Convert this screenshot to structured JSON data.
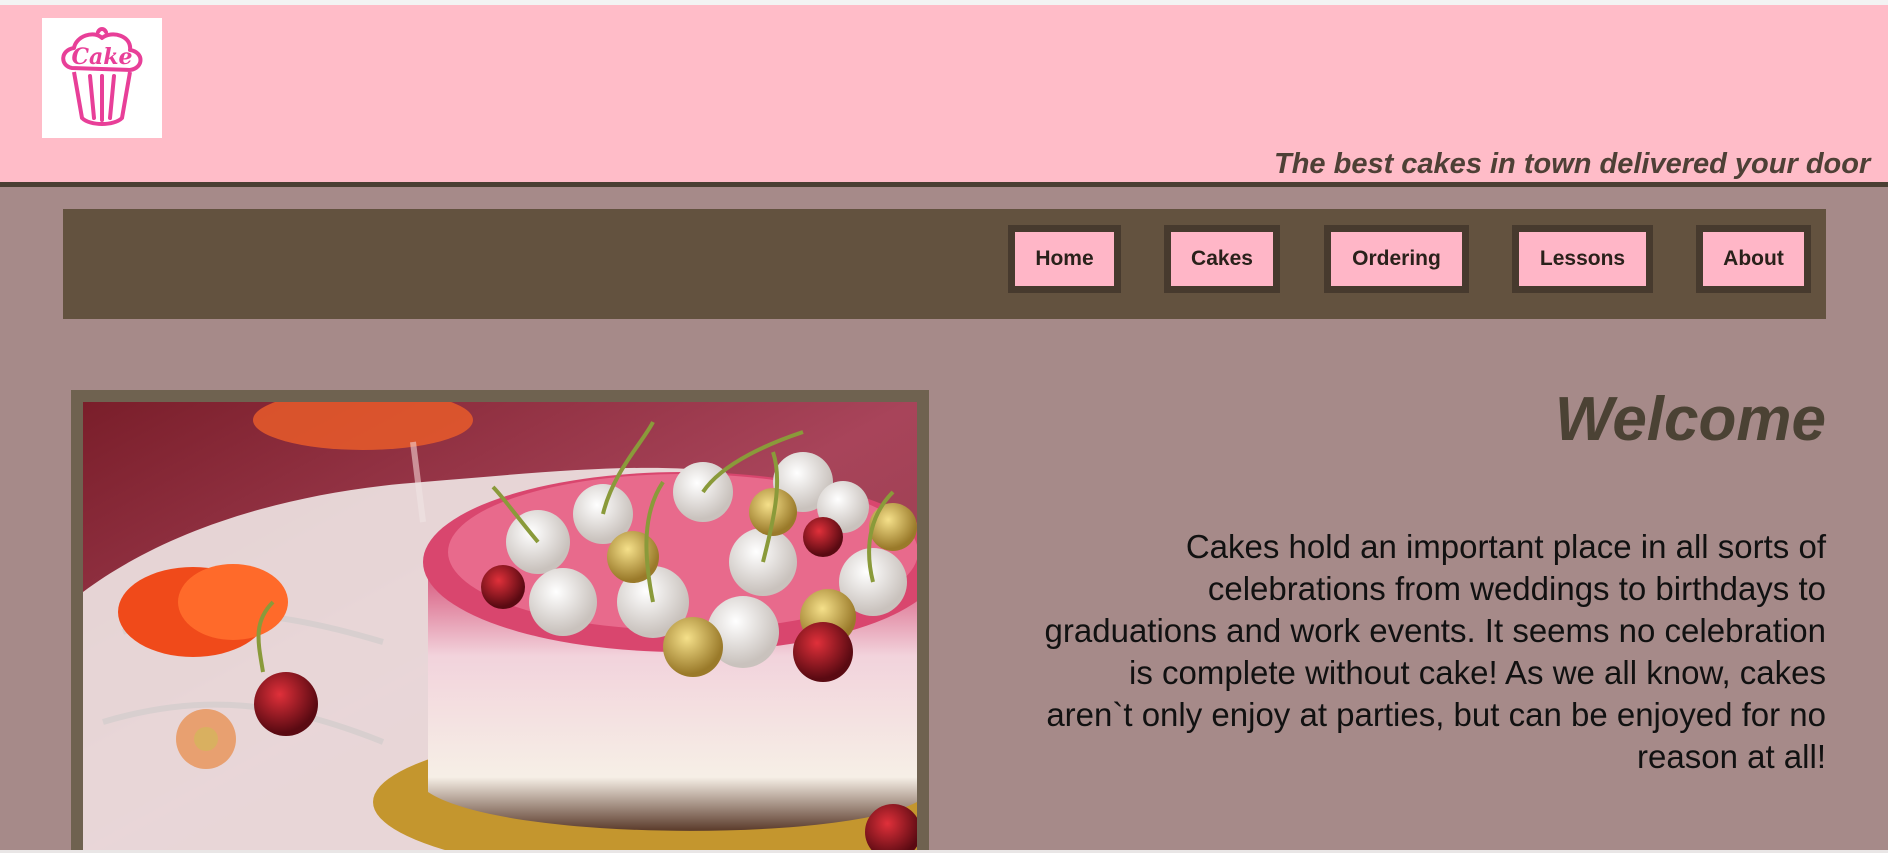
{
  "header": {
    "logo_text": "Cake",
    "tagline": "The best cakes in town delivered your door"
  },
  "nav": {
    "items": [
      {
        "label": "Home"
      },
      {
        "label": "Cakes"
      },
      {
        "label": "Ordering"
      },
      {
        "label": "Lessons"
      },
      {
        "label": "About"
      }
    ]
  },
  "main": {
    "title": "Welcome",
    "intro": "Cakes hold an important place in all sorts of celebrations from weddings to birthdays to graduations and work events. It seems no celebration is complete without cake! As we all know, cakes aren`t only enjoy at parties, but can be enjoyed for no reason at all!"
  },
  "colors": {
    "page_background": "#a68a89",
    "header_background": "#ffbcc8",
    "nav_background": "#63523f",
    "button_background": "#ffb6c7",
    "accent_dark": "#473a2e"
  }
}
